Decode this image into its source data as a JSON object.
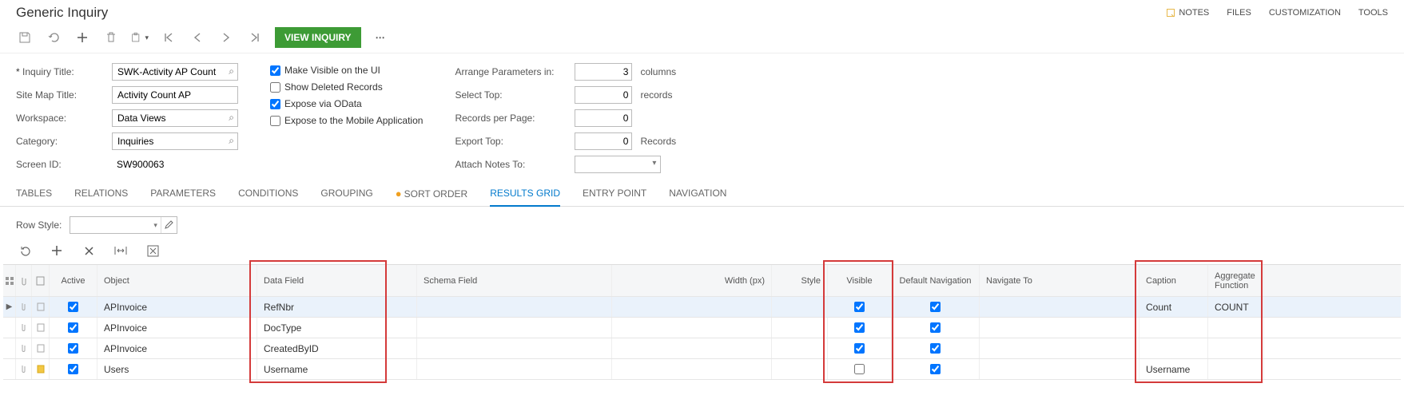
{
  "page_title": "Generic Inquiry",
  "header_links": {
    "notes": "NOTES",
    "files": "FILES",
    "customization": "CUSTOMIZATION",
    "tools": "TOOLS"
  },
  "toolbar": {
    "view_inquiry": "VIEW INQUIRY"
  },
  "form": {
    "inquiry_title_label": "Inquiry Title:",
    "inquiry_title_value": "SWK-Activity AP Count",
    "site_map_title_label": "Site Map Title:",
    "site_map_title_value": "Activity Count AP",
    "workspace_label": "Workspace:",
    "workspace_value": "Data Views",
    "category_label": "Category:",
    "category_value": "Inquiries",
    "screen_id_label": "Screen ID:",
    "screen_id_value": "SW900063",
    "chk_make_visible": "Make Visible on the UI",
    "chk_show_deleted": "Show Deleted Records",
    "chk_expose_odata": "Expose via OData",
    "chk_expose_mobile": "Expose to the Mobile Application",
    "arrange_params_label": "Arrange Parameters in:",
    "arrange_params_value": "3",
    "arrange_params_suffix": "columns",
    "select_top_label": "Select Top:",
    "select_top_value": "0",
    "select_top_suffix": "records",
    "records_per_page_label": "Records per Page:",
    "records_per_page_value": "0",
    "export_top_label": "Export Top:",
    "export_top_value": "0",
    "export_top_suffix": "Records",
    "attach_notes_label": "Attach Notes To:",
    "attach_notes_value": ""
  },
  "tabs": {
    "tables": "TABLES",
    "relations": "RELATIONS",
    "parameters": "PARAMETERS",
    "conditions": "CONDITIONS",
    "grouping": "GROUPING",
    "sort_order": "SORT ORDER",
    "results_grid": "RESULTS GRID",
    "entry_point": "ENTRY POINT",
    "navigation": "NAVIGATION"
  },
  "row_style_label": "Row Style:",
  "grid_headers": {
    "active": "Active",
    "object": "Object",
    "data_field": "Data Field",
    "schema_field": "Schema Field",
    "width": "Width (px)",
    "style": "Style",
    "visible": "Visible",
    "default_nav": "Default Navigation",
    "navigate_to": "Navigate To",
    "caption": "Caption",
    "aggregate": "Aggregate Function"
  },
  "rows": [
    {
      "object": "APInvoice",
      "data_field": "RefNbr",
      "visible": true,
      "default_nav": true,
      "caption": "Count",
      "aggregate": "COUNT",
      "note_yellow": false,
      "selected": true
    },
    {
      "object": "APInvoice",
      "data_field": "DocType",
      "visible": true,
      "default_nav": true,
      "caption": "",
      "aggregate": "",
      "note_yellow": false,
      "selected": false
    },
    {
      "object": "APInvoice",
      "data_field": "CreatedByID",
      "visible": true,
      "default_nav": true,
      "caption": "",
      "aggregate": "",
      "note_yellow": false,
      "selected": false
    },
    {
      "object": "Users",
      "data_field": "Username",
      "visible": false,
      "default_nav": true,
      "caption": "Username",
      "aggregate": "",
      "note_yellow": true,
      "selected": false
    }
  ]
}
